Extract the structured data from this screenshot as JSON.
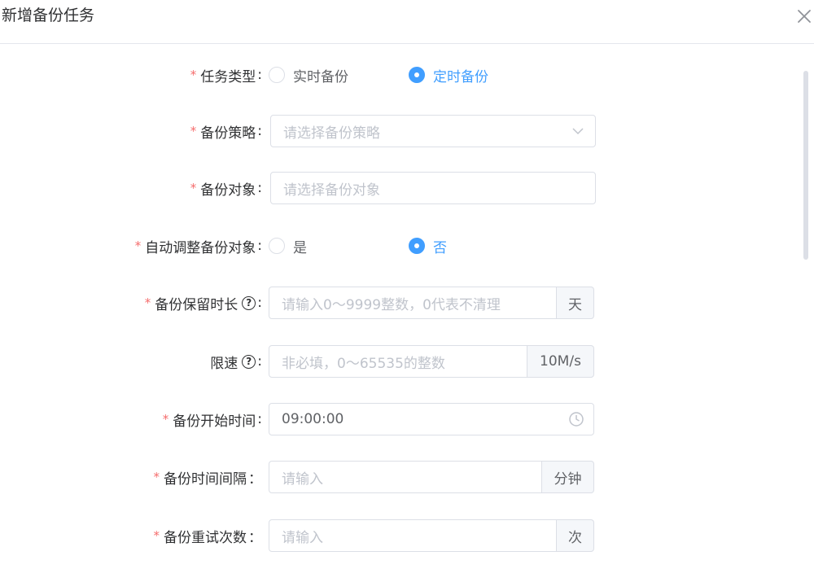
{
  "dialog": {
    "title": "新增备份任务"
  },
  "form": {
    "task_type": {
      "label": "任务类型",
      "options": [
        "实时备份",
        "定时备份"
      ],
      "selected": "定时备份"
    },
    "backup_policy": {
      "label": "备份策略",
      "placeholder": "请选择备份策略",
      "icon": "chevron-down-icon"
    },
    "backup_object": {
      "label": "备份对象",
      "placeholder": "请选择备份对象"
    },
    "auto_adjust": {
      "label": "自动调整备份对象",
      "options": [
        "是",
        "否"
      ],
      "selected": "否"
    },
    "retention": {
      "label": "备份保留时长",
      "placeholder": "请输入0～9999整数，0代表不清理",
      "unit": "天",
      "help_icon": "question-circle-icon"
    },
    "rate_limit": {
      "label": "限速",
      "placeholder": "非必填，0～65535的整数",
      "unit": "10M/s",
      "help_icon": "question-circle-icon"
    },
    "start_time": {
      "label": "备份开始时间",
      "value": "09:00:00",
      "icon": "clock-icon"
    },
    "interval": {
      "label": "备份时间间隔",
      "placeholder": "请输入",
      "unit": "分钟"
    },
    "retry": {
      "label": "备份重试次数",
      "placeholder": "请输入",
      "unit": "次"
    }
  },
  "labels": {
    "colon": ":",
    "colon_wide": "：",
    "required_mark": "*",
    "help_glyph": "?"
  },
  "colors": {
    "primary": "#409eff",
    "required": "#f56c6c",
    "placeholder": "#c0c4cc",
    "border": "#dcdfe6"
  }
}
